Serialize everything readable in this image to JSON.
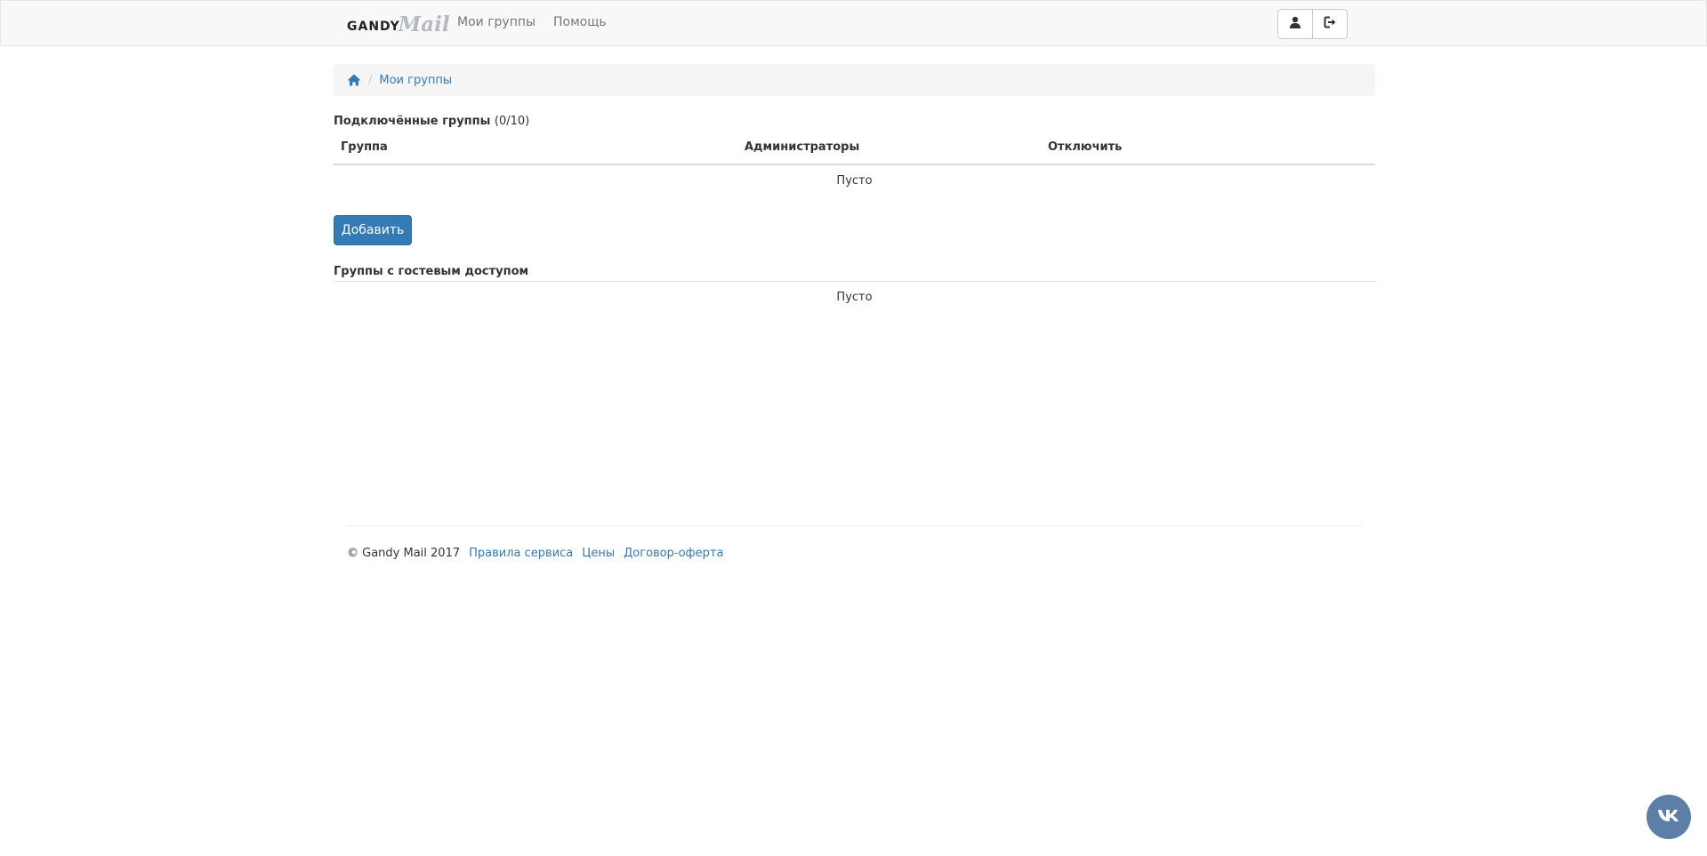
{
  "navbar": {
    "brand_gandy": "GANDY",
    "brand_mail": "Mail",
    "links": [
      {
        "label": "Мои группы"
      },
      {
        "label": "Помощь"
      }
    ],
    "buttons": [
      {
        "icon": "user-icon"
      },
      {
        "icon": "logout-icon"
      }
    ]
  },
  "breadcrumb": {
    "home_icon": "home-icon",
    "separator": "/",
    "current": "Мои группы"
  },
  "connected": {
    "title": "Подключённые группы",
    "count": "(0/10)",
    "columns": [
      "Группа",
      "Администраторы",
      "Отключить"
    ],
    "empty_text": "Пусто",
    "add_button": "Добавить"
  },
  "guest": {
    "title": "Группы с гостевым доступом",
    "empty_text": "Пусто"
  },
  "footer": {
    "copyright": "© Gandy Mail 2017",
    "links": [
      "Правила сервиса",
      "Цены",
      "Договор-оферта"
    ]
  },
  "widget": {
    "icon": "vk-icon"
  },
  "colors": {
    "link": "#337ab7",
    "primary": "#337ab7",
    "navbar_bg": "#f8f8f8",
    "vk": "#5b7fa6"
  }
}
